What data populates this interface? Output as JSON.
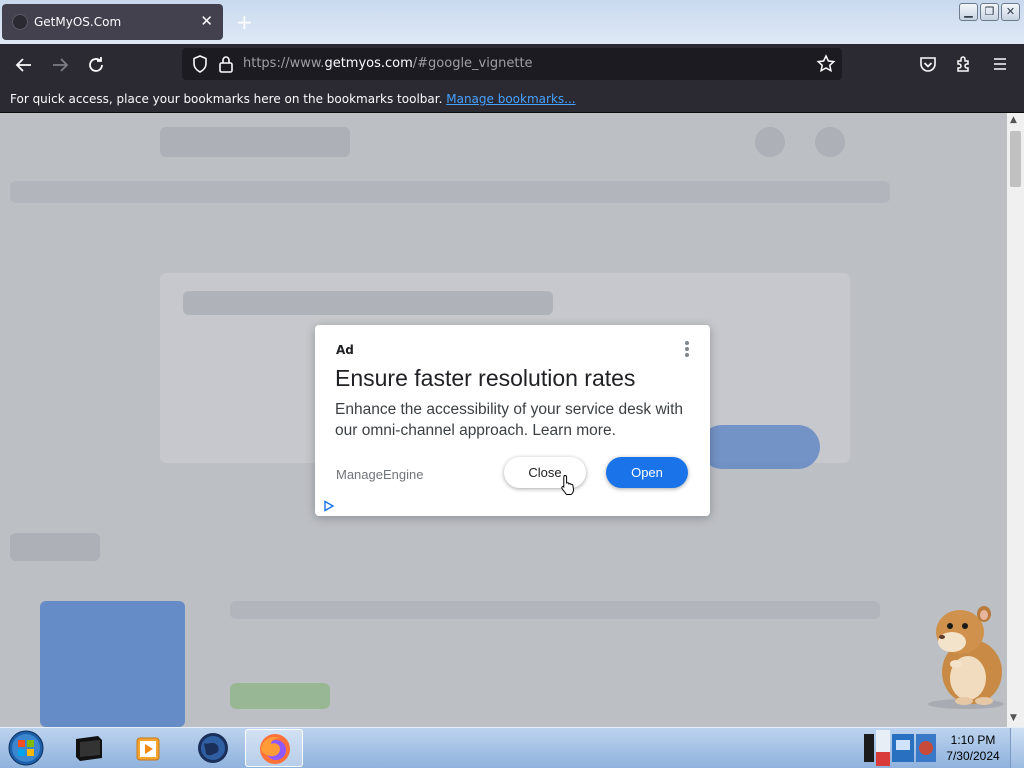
{
  "browser": {
    "tab": {
      "title": "GetMyOS.Com",
      "close_glyph": "✕"
    },
    "new_tab_glyph": "+",
    "window_buttons": [
      "minimize-icon",
      "restore-icon",
      "close-icon"
    ],
    "nav": {
      "back_icon": "back-arrow-icon",
      "forward_icon": "forward-arrow-icon",
      "reload_icon": "reload-icon"
    },
    "url": {
      "prefix": "https://www.",
      "domain": "getmyos.com",
      "suffix": "/#google_vignette"
    },
    "toolbar_icons": [
      "pocket-icon",
      "extensions-icon",
      "hamburger-menu-icon"
    ],
    "bookmarks_bar": {
      "message": "For quick access, place your bookmarks here on the bookmarks toolbar.",
      "link": "Manage bookmarks..."
    }
  },
  "ad": {
    "label": "Ad",
    "title": "Ensure faster resolution rates",
    "description": "Enhance the accessibility of your service desk with our omni-channel approach. Learn more.",
    "advertiser": "ManageEngine",
    "close_button": "Close",
    "open_button": "Open",
    "accent": "#1a73e8"
  },
  "taskbar": {
    "items": [
      "start-orb-icon",
      "terminal-icon",
      "media-player-icon",
      "globe-icon",
      "firefox-icon"
    ],
    "clock": {
      "time": "1:10 PM",
      "date": "7/30/2024"
    }
  }
}
